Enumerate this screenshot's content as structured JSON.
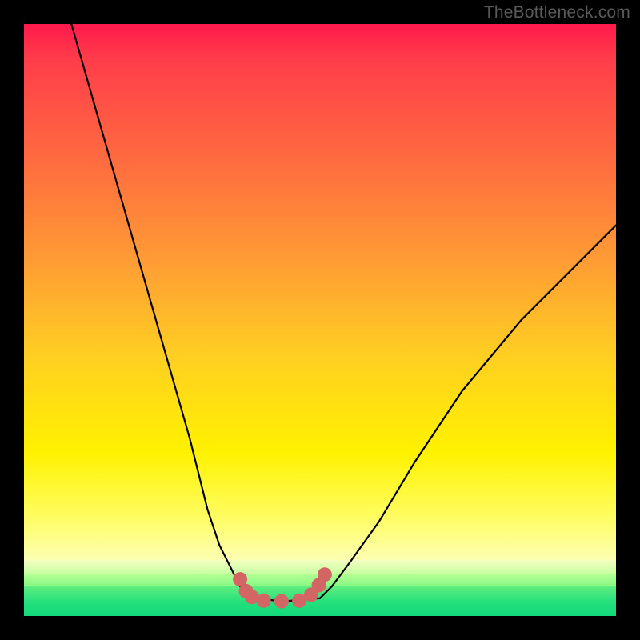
{
  "watermark": "TheBottleneck.com",
  "colors": {
    "page_bg": "#000000",
    "curve_stroke": "#000000",
    "marker_stroke": "#d46565",
    "marker_fill": "#d46565"
  },
  "chart_data": {
    "type": "line",
    "title": "",
    "xlabel": "",
    "ylabel": "",
    "xlim": [
      0,
      100
    ],
    "ylim": [
      0,
      100
    ],
    "grid": false,
    "legend": false,
    "series": [
      {
        "name": "left-curve",
        "x": [
          8,
          12,
          16,
          20,
          24,
          28,
          31,
          33,
          35,
          36.5,
          38
        ],
        "y": [
          100,
          86,
          72,
          58,
          44,
          30,
          18,
          12,
          8,
          5,
          3
        ]
      },
      {
        "name": "floor",
        "x": [
          38,
          44,
          50
        ],
        "y": [
          3,
          2.5,
          3
        ]
      },
      {
        "name": "right-curve",
        "x": [
          50,
          52,
          55,
          60,
          66,
          74,
          84,
          94,
          100
        ],
        "y": [
          3,
          5,
          9,
          16,
          26,
          38,
          50,
          60,
          66
        ]
      }
    ],
    "markers": {
      "name": "highlight-dots",
      "points": [
        {
          "x": 36.5,
          "y": 6.2
        },
        {
          "x": 37.5,
          "y": 4.2
        },
        {
          "x": 38.5,
          "y": 3.2
        },
        {
          "x": 40.5,
          "y": 2.6
        },
        {
          "x": 43.5,
          "y": 2.5
        },
        {
          "x": 46.5,
          "y": 2.6
        },
        {
          "x": 48.5,
          "y": 3.6
        },
        {
          "x": 49.8,
          "y": 5.2
        },
        {
          "x": 50.8,
          "y": 7.0
        }
      ],
      "radius": 9
    },
    "gradient_stops": [
      {
        "pct": 0,
        "color": "#ff1a4b"
      },
      {
        "pct": 45,
        "color": "#ff9e34"
      },
      {
        "pct": 80,
        "color": "#fff200"
      },
      {
        "pct": 93,
        "color": "#d8ffaf"
      },
      {
        "pct": 100,
        "color": "#12d97a"
      }
    ]
  }
}
